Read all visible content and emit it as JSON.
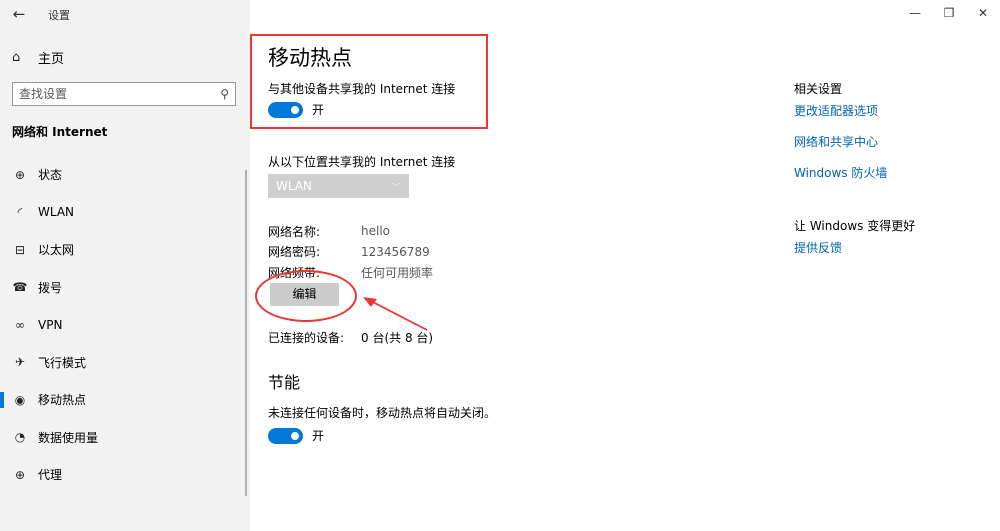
{
  "window": {
    "app_title": "设置",
    "back_icon": "←",
    "controls": [
      "—",
      "❐",
      "✕"
    ]
  },
  "sidebar": {
    "home_label": "主页",
    "search_placeholder": "查找设置",
    "section_label": "网络和 Internet",
    "items": [
      {
        "label": "状态",
        "icon": "globe-status-icon",
        "glyph": "⊕"
      },
      {
        "label": "WLAN",
        "icon": "wifi-icon",
        "glyph": "◜"
      },
      {
        "label": "以太网",
        "icon": "ethernet-icon",
        "glyph": "⊟"
      },
      {
        "label": "拨号",
        "icon": "dialup-icon",
        "glyph": "☎"
      },
      {
        "label": "VPN",
        "icon": "vpn-icon",
        "glyph": "∞"
      },
      {
        "label": "飞行模式",
        "icon": "airplane-icon",
        "glyph": "✈"
      },
      {
        "label": "移动热点",
        "icon": "hotspot-icon",
        "glyph": "◉",
        "active": true
      },
      {
        "label": "数据使用量",
        "icon": "data-usage-icon",
        "glyph": "◔"
      },
      {
        "label": "代理",
        "icon": "proxy-globe-icon",
        "glyph": "⊕"
      }
    ]
  },
  "main": {
    "title": "移动热点",
    "share_label": "与其他设备共享我的 Internet 连接",
    "share_toggle_state": "开",
    "from_label": "从以下位置共享我的 Internet 连接",
    "source_select": "WLAN",
    "network_name_key": "网络名称:",
    "network_name_val": "hello",
    "network_pwd_key": "网络密码:",
    "network_pwd_val": "123456789",
    "network_band_key": "网络频带:",
    "network_band_val": "任何可用频率",
    "edit_button": "编辑",
    "connected_key": "已连接的设备:",
    "connected_val": "0 台(共 8 台)",
    "power_title": "节能",
    "power_desc": "未连接任何设备时，移动热点将自动关闭。",
    "power_toggle_state": "开"
  },
  "right_panel": {
    "related_title": "相关设置",
    "links": [
      "更改适配器选项",
      "网络和共享中心",
      "Windows 防火墙"
    ],
    "better_title": "让 Windows 变得更好",
    "feedback_link": "提供反馈"
  },
  "colors": {
    "accent": "#0078d7",
    "link": "#0063b1",
    "annotation": "#e53935"
  }
}
